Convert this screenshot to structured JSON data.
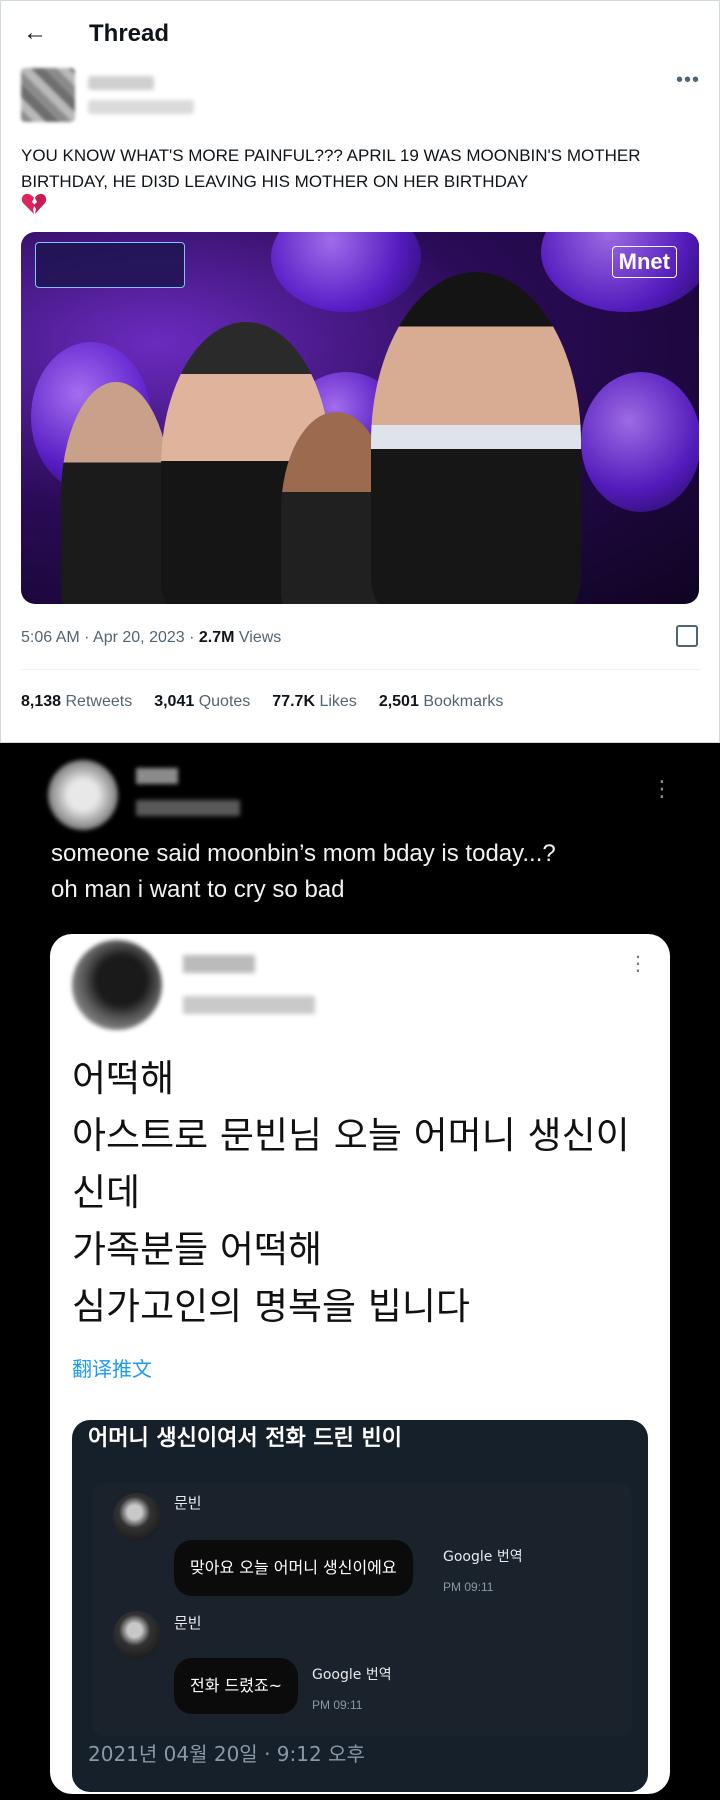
{
  "header": {
    "title": "Thread",
    "back_icon": "arrow-left-icon",
    "more_icon": "more-horizontal-icon"
  },
  "tweet": {
    "text": "YOU KNOW WHAT'S MORE PAINFUL??? APRIL 19 WAS MOONBIN'S MOTHER BIRTHDAY, HE DI3D LEAVING HIS MOTHER ON HER BIRTHDAY",
    "emoji_icon": "broken-heart-icon",
    "media_logo": "Mnet",
    "timestamp": "5:06 AM · Apr 20, 2023 · ",
    "views_count": "2.7M",
    "views_label": " Views",
    "stats": {
      "retweets_count": "8,138",
      "retweets_label": "Retweets",
      "quotes_count": "3,041",
      "quotes_label": "Quotes",
      "likes_count": "77.7K",
      "likes_label": "Likes",
      "bookmarks_count": "2,501",
      "bookmarks_label": "Bookmarks"
    }
  },
  "dark_post": {
    "text_line1": "someone said moonbin’s mom bday is today...?",
    "text_line2": "oh man i want to cry so bad"
  },
  "quoted_post": {
    "lines": [
      "어떡해",
      "아스트로 문빈님 오늘 어머니 생신이",
      "신데",
      "가족분들 어떡해",
      "심가고인의 명복을 빕니다"
    ],
    "translate_label": "翻译推文"
  },
  "dm_screenshot": {
    "title": "어머니 생신이여서 전화 드린 빈이",
    "messages": [
      {
        "sender": "문빈",
        "text": "맞아요 오늘 어머니 생신이에요",
        "translator": "Google 번역",
        "time": "PM 09:11"
      },
      {
        "sender": "문빈",
        "text": "전화 드렸죠~",
        "translator": "Google 번역",
        "time": "PM 09:11"
      }
    ],
    "date": "2021년 04월 20일 · 9:12 오후"
  },
  "colors": {
    "accent": "#1d9bf0",
    "light_bg": "#ffffff",
    "dark_bg": "#000000",
    "dm_bg": "#15202b"
  }
}
